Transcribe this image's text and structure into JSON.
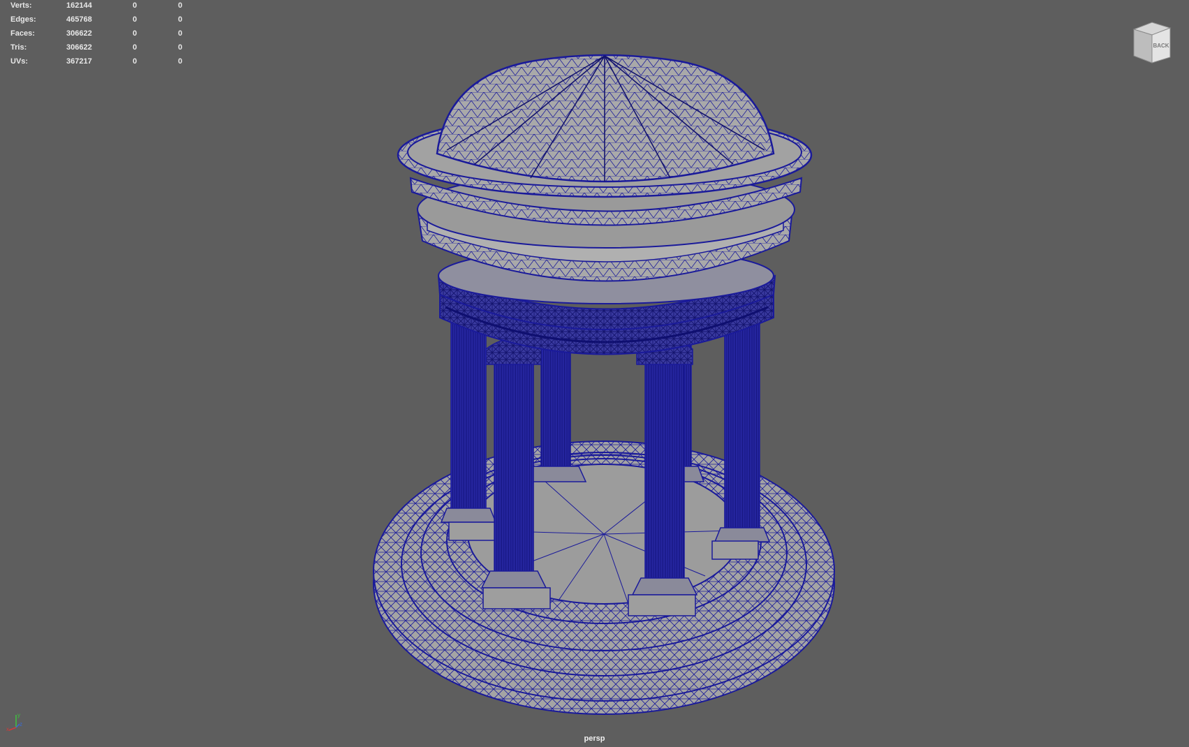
{
  "heads_up": {
    "rows": [
      {
        "label": "Verts:",
        "value": "162144",
        "sel": "0",
        "comp": "0"
      },
      {
        "label": "Edges:",
        "value": "465768",
        "sel": "0",
        "comp": "0"
      },
      {
        "label": "Faces:",
        "value": "306622",
        "sel": "0",
        "comp": "0"
      },
      {
        "label": "Tris:",
        "value": "306622",
        "sel": "0",
        "comp": "0"
      },
      {
        "label": "UVs:",
        "value": "367217",
        "sel": "0",
        "comp": "0"
      }
    ]
  },
  "viewcube": {
    "face_label": "BACK"
  },
  "camera": {
    "name": "persp"
  },
  "axis": {
    "x": "x",
    "y": "y",
    "z": "z"
  },
  "colors": {
    "background": "#5e5e5e",
    "wire": "#1a1a9a",
    "mesh": "#a6a6a6"
  }
}
